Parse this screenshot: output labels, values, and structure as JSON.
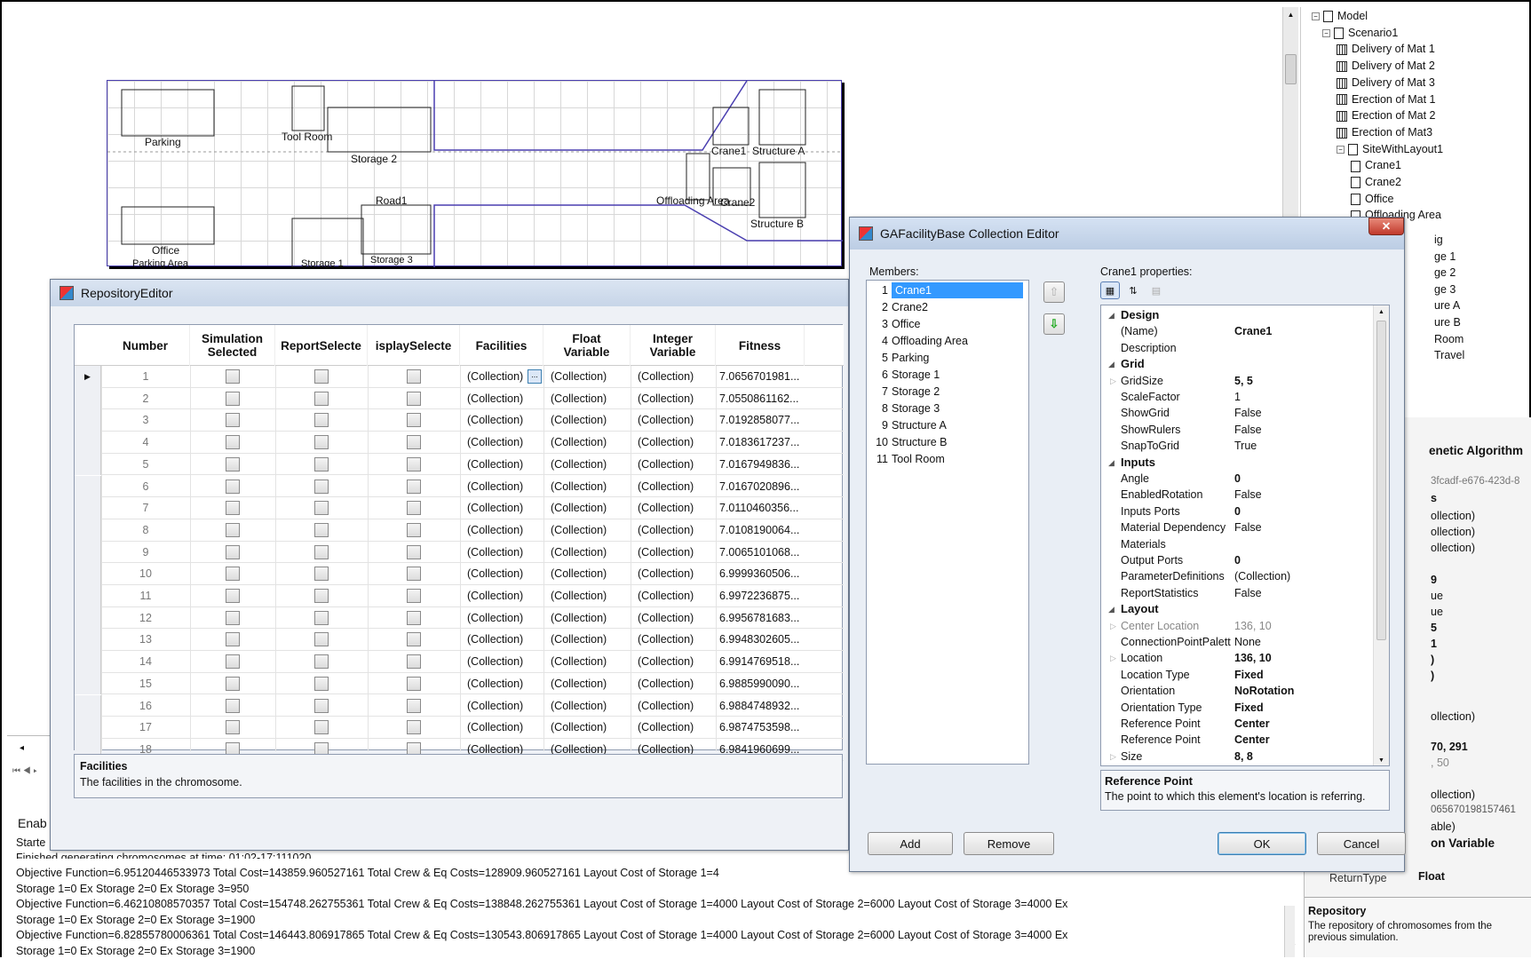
{
  "layout_canvas": {
    "labels": {
      "parking": "Parking",
      "tool_room": "Tool Room",
      "storage2": "Storage 2",
      "crane1": "Crane1",
      "structure_a": "Structure A",
      "offloading": "Offloading Area",
      "crane2": "Crane2",
      "structure_b": "Structure B",
      "road1": "Road1",
      "office": "Office",
      "parking_area": "Parking Area",
      "storage1": "Storage 1",
      "storage3": "Storage 3"
    }
  },
  "tree": {
    "items": [
      {
        "label": "Model",
        "icon": "doc",
        "toggle": "−"
      },
      {
        "label": "Scenario1",
        "icon": "doc",
        "toggle": "−"
      },
      {
        "label": "Delivery of Mat 1",
        "icon": "film"
      },
      {
        "label": "Delivery of Mat 2",
        "icon": "film"
      },
      {
        "label": "Delivery of Mat 3",
        "icon": "film"
      },
      {
        "label": "Erection of Mat 1",
        "icon": "film"
      },
      {
        "label": "Erection of Mat 2",
        "icon": "film"
      },
      {
        "label": "Erection of Mat3",
        "icon": "film"
      },
      {
        "label": "SiteWithLayout1",
        "icon": "doc",
        "toggle": "−"
      },
      {
        "label": "Crane1",
        "icon": "doc"
      },
      {
        "label": "Crane2",
        "icon": "doc"
      },
      {
        "label": "Office",
        "icon": "doc"
      },
      {
        "label": "Offloading Area",
        "icon": "doc"
      }
    ],
    "partial": [
      "ig",
      "ge 1",
      "ge 2",
      "ge 3",
      "ure A",
      "ure B",
      "Room",
      "Travel"
    ]
  },
  "right_panel": {
    "genetic_algorithm": "enetic Algorithm",
    "guid": "3fcadf-e676-423d-8",
    "s_label": "s",
    "coll1": "ollection)",
    "coll2": "ollection)",
    "coll3": "ollection)",
    "nine": "9",
    "ue1": "ue",
    "ue2": "ue",
    "five": "5",
    "one": "1",
    "paren1": ")",
    "paren2": ")",
    "coll4": "ollection)",
    "loc": "70, 291",
    "fifty": ", 50",
    "coll5": "ollection)",
    "fitness": "065670198157461",
    "able": "able)",
    "float_var": "on Variable",
    "return_type": "ReturnType",
    "float": "Float",
    "repo_title": "Repository",
    "repo_desc": "The repository of chromosomes from the previous simulation."
  },
  "repo_editor": {
    "title": "RepositoryEditor",
    "columns": [
      "Number",
      "Simulation Selected",
      "ReportSelected",
      "DisplaySelected",
      "Facilities",
      "Float Variable",
      "Integer Variable",
      "Fitness"
    ],
    "column_display": [
      "Number",
      "Simulation\nSelected",
      "ReportSelecte",
      "isplaySelecte",
      "Facilities",
      "Float\nVariable",
      "Integer\nVariable",
      "Fitness"
    ],
    "collection": "(Collection)",
    "rows": [
      {
        "n": "1",
        "fitness": "7.0656701981..."
      },
      {
        "n": "2",
        "fitness": "7.0550861162..."
      },
      {
        "n": "3",
        "fitness": "7.0192858077..."
      },
      {
        "n": "4",
        "fitness": "7.0183617237..."
      },
      {
        "n": "5",
        "fitness": "7.0167949836..."
      },
      {
        "n": "6",
        "fitness": "7.0167020896..."
      },
      {
        "n": "7",
        "fitness": "7.0110460356..."
      },
      {
        "n": "8",
        "fitness": "7.0108190064..."
      },
      {
        "n": "9",
        "fitness": "7.0065101068..."
      },
      {
        "n": "10",
        "fitness": "6.9999360506..."
      },
      {
        "n": "11",
        "fitness": "6.9972236875..."
      },
      {
        "n": "12",
        "fitness": "6.9956781683..."
      },
      {
        "n": "13",
        "fitness": "6.9948302605..."
      },
      {
        "n": "14",
        "fitness": "6.9914769518..."
      },
      {
        "n": "15",
        "fitness": "6.9885990090..."
      },
      {
        "n": "16",
        "fitness": "6.9884748932..."
      },
      {
        "n": "17",
        "fitness": "6.9874753598..."
      },
      {
        "n": "18",
        "fitness": "6.9841960699..."
      }
    ],
    "desc_title": "Facilities",
    "desc_text": "The facilities in the chromosome."
  },
  "collection_editor": {
    "title": "GAFacilityBase Collection Editor",
    "members_label": "Members:",
    "members": [
      "Crane1",
      "Crane2",
      "Office",
      "Offloading Area",
      "Parking",
      "Storage 1",
      "Storage 2",
      "Storage 3",
      "Structure A",
      "Structure B",
      "Tool Room"
    ],
    "props_label": "Crane1 properties:",
    "sections": [
      {
        "name": "Design",
        "props": [
          {
            "k": "(Name)",
            "v": "Crane1",
            "bold": true
          },
          {
            "k": "Description",
            "v": ""
          }
        ]
      },
      {
        "name": "Grid",
        "props": [
          {
            "k": "GridSize",
            "v": "5, 5",
            "bold": true,
            "expand": true
          },
          {
            "k": "ScaleFactor",
            "v": "1"
          },
          {
            "k": "ShowGrid",
            "v": "False"
          },
          {
            "k": "ShowRulers",
            "v": "False"
          },
          {
            "k": "SnapToGrid",
            "v": "True"
          }
        ]
      },
      {
        "name": "Inputs",
        "props": [
          {
            "k": "Angle",
            "v": "0",
            "bold": true
          },
          {
            "k": "EnabledRotation",
            "v": "False"
          },
          {
            "k": "Inputs Ports",
            "v": "0",
            "bold": true
          },
          {
            "k": "Material Dependency",
            "v": "False"
          },
          {
            "k": "Materials",
            "v": ""
          },
          {
            "k": "Output Ports",
            "v": "0",
            "bold": true
          },
          {
            "k": "ParameterDefinitions",
            "v": "(Collection)"
          },
          {
            "k": "ReportStatistics",
            "v": "False"
          }
        ]
      },
      {
        "name": "Layout",
        "props": [
          {
            "k": "Center Location",
            "v": "136, 10",
            "grey": true,
            "expand": true
          },
          {
            "k": "ConnectionPointPalett",
            "v": "None"
          },
          {
            "k": "Location",
            "v": "136, 10",
            "bold": true,
            "expand": true
          },
          {
            "k": "Location Type",
            "v": "Fixed",
            "bold": true
          },
          {
            "k": "Orientation",
            "v": "NoRotation",
            "bold": true
          },
          {
            "k": "Orientation Type",
            "v": "Fixed",
            "bold": true
          },
          {
            "k": "Reference Point",
            "v": "Center",
            "bold": true
          },
          {
            "k": "Reference Point",
            "v": "Center",
            "bold": true
          },
          {
            "k": "Size",
            "v": "8, 8",
            "bold": true,
            "expand": true
          }
        ]
      }
    ],
    "desc_title": "Reference Point",
    "desc_text": "The point to which this element's location is referring.",
    "add": "Add",
    "remove": "Remove",
    "ok": "OK",
    "cancel": "Cancel"
  },
  "output": {
    "enab": "Enab",
    "start": "Starte",
    "finished": "Finished generating chromosomes at time: 01:02-17:111020",
    "lines": [
      "Objective Function=6.95120446533973 Total Cost=143859.960527161 Total Crew & Eq Costs=128909.960527161 Layout Cost of Storage 1=4",
      "Storage 1=0 Ex Storage 2=0 Ex Storage 3=950",
      "Objective Function=6.46210808570357 Total Cost=154748.262755361 Total Crew & Eq Costs=138848.262755361 Layout Cost of Storage 1=4000 Layout Cost of Storage 2=6000 Layout Cost of Storage 3=4000 Ex",
      "Storage 1=0 Ex Storage 2=0 Ex Storage 3=1900",
      "Objective Function=6.82855780006361 Total Cost=146443.806917865 Total Crew & Eq Costs=130543.806917865 Layout Cost of Storage 1=4000 Layout Cost of Storage 2=6000 Layout Cost of Storage 3=4000 Ex",
      "Storage 1=0 Ex Storage 2=0 Ex Storage 3=1900"
    ]
  }
}
